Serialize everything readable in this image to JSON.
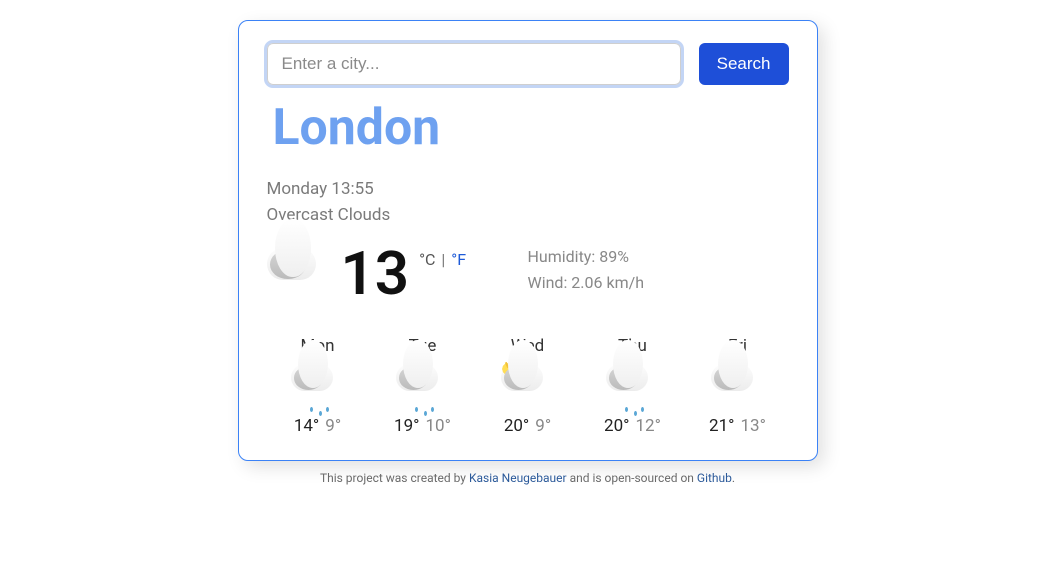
{
  "search": {
    "placeholder": "Enter a city...",
    "button": "Search"
  },
  "city": "London",
  "datetime": "Monday 13:55",
  "condition": "Overcast Clouds",
  "current": {
    "temp": "13",
    "unit_c": "°C",
    "sep": "|",
    "unit_f": "°F",
    "icon": "cloud"
  },
  "details": {
    "humidity_label": "Humidity:",
    "humidity_value": "89%",
    "wind_label": "Wind:",
    "wind_value": "2.06 km/h"
  },
  "forecast": [
    {
      "day": "Mon",
      "hi": "14°",
      "lo": "9°",
      "icon": "cloud-rain"
    },
    {
      "day": "Tue",
      "hi": "19°",
      "lo": "10°",
      "icon": "cloud-rain"
    },
    {
      "day": "Wed",
      "hi": "20°",
      "lo": "9°",
      "icon": "cloud-sun"
    },
    {
      "day": "Thu",
      "hi": "20°",
      "lo": "12°",
      "icon": "cloud-rain"
    },
    {
      "day": "Fri",
      "hi": "21°",
      "lo": "13°",
      "icon": "cloud"
    }
  ],
  "footer": {
    "pre": "This project was created by ",
    "author": "Kasia Neugebauer",
    "mid": " and is open-sourced on ",
    "link": "Github",
    "post": "."
  }
}
